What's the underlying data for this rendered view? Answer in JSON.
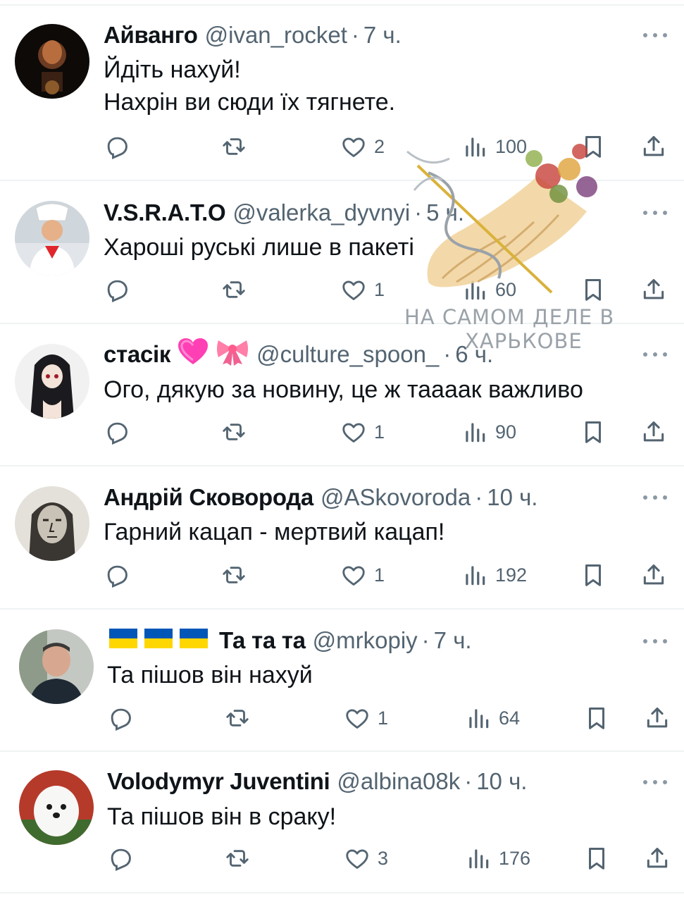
{
  "watermark": {
    "line1": "НА САМОМ ДЕЛЕ В",
    "line2": "ХАРЬКОВЕ"
  },
  "tweets": [
    {
      "name": "Айванго",
      "handle": "@ivan_rocket",
      "dot": "·",
      "time": "7 ч.",
      "text": [
        "Йдіть нахуй!",
        "Нахрін ви сюди їх тягнете."
      ],
      "likes": "2",
      "views": "100",
      "avatar": "dark-portrait"
    },
    {
      "name": "V.S.R.A.T.O",
      "handle": "@valerka_dyvnyi",
      "dot": "·",
      "time": "5 ч.",
      "text": [
        "Хароші руські лише в пакеті"
      ],
      "likes": "1",
      "views": "60",
      "avatar": "chef"
    },
    {
      "name": "стасік",
      "handle": "@culture_spoon_",
      "dot": "·",
      "time": "6 ч.",
      "text": [
        "Ого, дякую за новину, це ж таааак важливо"
      ],
      "likes": "1",
      "views": "90",
      "avatar": "anime"
    },
    {
      "name": "Андрій Сковорода",
      "handle": "@ASkovoroda",
      "dot": "·",
      "time": "10 ч.",
      "text": [
        "Гарний кацап - мертвий кацап!"
      ],
      "likes": "1",
      "views": "192",
      "avatar": "engraving"
    },
    {
      "name": "Та та та",
      "handle": "@mrkopiy",
      "dot": "·",
      "time": "7 ч.",
      "text": [
        "Та пішов він нахуй"
      ],
      "likes": "1",
      "views": "64",
      "avatar": "man"
    },
    {
      "name": "Volodymyr Juventini",
      "handle": "@albina08k",
      "dot": "·",
      "time": "10 ч.",
      "text": [
        "Та пішов він в сраку!"
      ],
      "likes": "3",
      "views": "176",
      "avatar": "dog"
    }
  ],
  "icons": {
    "reply": "reply-icon",
    "retweet": "retweet-icon",
    "like": "heart-icon",
    "views": "views-icon",
    "bookmark": "bookmark-icon",
    "share": "share-icon",
    "more": "more-icon"
  },
  "colors": {
    "text": "#0f1419",
    "muted": "#536471",
    "divider": "#eff3f4",
    "flag_blue": "#0057b7",
    "flag_yellow": "#ffd700"
  }
}
